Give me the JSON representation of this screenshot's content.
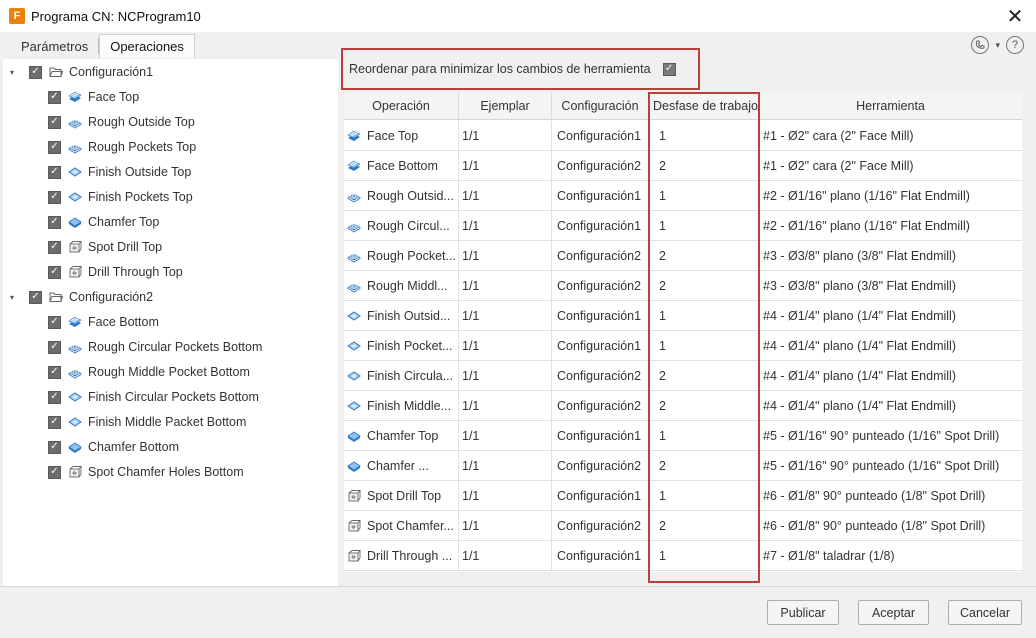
{
  "window": {
    "app_icon_letter": "F",
    "title": "Programa CN: NCProgram10",
    "close_glyph": "✕"
  },
  "tabs": [
    {
      "label": "Parámetros",
      "active": false
    },
    {
      "label": "Operaciones",
      "active": true
    }
  ],
  "header_icons": [
    "phone-icon",
    "chevron-down-icon",
    "help-icon"
  ],
  "tree": {
    "groups": [
      {
        "label": "Configuración1",
        "checked": true,
        "items": [
          {
            "label": "Face Top",
            "icon": "face-icon"
          },
          {
            "label": "Rough Outside Top",
            "icon": "adaptive-icon"
          },
          {
            "label": "Rough Pockets Top",
            "icon": "adaptive-icon"
          },
          {
            "label": "Finish Outside Top",
            "icon": "contour-icon"
          },
          {
            "label": "Finish Pockets Top",
            "icon": "contour-icon"
          },
          {
            "label": "Chamfer Top",
            "icon": "chamfer-icon"
          },
          {
            "label": "Spot Drill Top",
            "icon": "drill-icon"
          },
          {
            "label": "Drill Through Top",
            "icon": "drill-icon"
          }
        ]
      },
      {
        "label": "Configuración2",
        "checked": true,
        "items": [
          {
            "label": "Face Bottom",
            "icon": "face-icon"
          },
          {
            "label": "Rough Circular Pockets Bottom",
            "icon": "adaptive-icon"
          },
          {
            "label": "Rough Middle Pocket Bottom",
            "icon": "adaptive-icon"
          },
          {
            "label": "Finish Circular Pockets Bottom",
            "icon": "contour-icon"
          },
          {
            "label": "Finish Middle Packet Bottom",
            "icon": "contour-icon"
          },
          {
            "label": "Chamfer Bottom",
            "icon": "chamfer-icon"
          },
          {
            "label": "Spot Chamfer Holes Bottom",
            "icon": "drill-icon"
          }
        ]
      }
    ]
  },
  "reorder": {
    "label": "Reordenar para minimizar los cambios de herramienta",
    "checked": true
  },
  "table": {
    "columns": [
      "Operación",
      "Ejemplar",
      "Configuración",
      "Desfase de trabajo",
      "Herramienta"
    ],
    "rows": [
      {
        "op": "Face Top",
        "icon": "face-icon",
        "ejemplar": "1/1",
        "config": "Configuración1",
        "offset": "1",
        "tool": "#1 - Ø2\" cara (2\" Face Mill)"
      },
      {
        "op": "Face Bottom",
        "icon": "face-icon",
        "ejemplar": "1/1",
        "config": "Configuración2",
        "offset": "2",
        "tool": "#1 - Ø2\" cara (2\" Face Mill)"
      },
      {
        "op": "Rough Outsid...",
        "icon": "adaptive-icon",
        "ejemplar": "1/1",
        "config": "Configuración1",
        "offset": "1",
        "tool": "#2 - Ø1/16\" plano (1/16\" Flat Endmill)"
      },
      {
        "op": "Rough Circul...",
        "icon": "adaptive-icon",
        "ejemplar": "1/1",
        "config": "Configuración1",
        "offset": "1",
        "tool": "#2 - Ø1/16\" plano (1/16\" Flat Endmill)"
      },
      {
        "op": "Rough Pocket...",
        "icon": "adaptive-icon",
        "ejemplar": "1/1",
        "config": "Configuración2",
        "offset": "2",
        "tool": "#3 - Ø3/8\" plano (3/8\" Flat Endmill)"
      },
      {
        "op": "Rough Middl...",
        "icon": "adaptive-icon",
        "ejemplar": "1/1",
        "config": "Configuración2",
        "offset": "2",
        "tool": "#3 - Ø3/8\" plano (3/8\" Flat Endmill)"
      },
      {
        "op": "Finish Outsid...",
        "icon": "contour-icon",
        "ejemplar": "1/1",
        "config": "Configuración1",
        "offset": "1",
        "tool": "#4 - Ø1/4\" plano (1/4\" Flat Endmill)"
      },
      {
        "op": "Finish Pocket...",
        "icon": "contour-icon",
        "ejemplar": "1/1",
        "config": "Configuración1",
        "offset": "1",
        "tool": "#4 - Ø1/4\" plano (1/4\" Flat Endmill)"
      },
      {
        "op": "Finish Circula...",
        "icon": "contour-icon",
        "ejemplar": "1/1",
        "config": "Configuración2",
        "offset": "2",
        "tool": "#4 - Ø1/4\" plano (1/4\" Flat Endmill)"
      },
      {
        "op": "Finish Middle...",
        "icon": "contour-icon",
        "ejemplar": "1/1",
        "config": "Configuración2",
        "offset": "2",
        "tool": "#4 - Ø1/4\" plano (1/4\" Flat Endmill)"
      },
      {
        "op": "Chamfer Top",
        "icon": "chamfer-icon",
        "ejemplar": "1/1",
        "config": "Configuración1",
        "offset": "1",
        "tool": "#5 - Ø1/16\" 90° punteado (1/16\" Spot Drill)"
      },
      {
        "op": "Chamfer ...",
        "icon": "chamfer-icon",
        "ejemplar": "1/1",
        "config": "Configuración2",
        "offset": "2",
        "tool": "#5 - Ø1/16\" 90° punteado (1/16\" Spot Drill)"
      },
      {
        "op": "Spot Drill Top",
        "icon": "drill-icon",
        "ejemplar": "1/1",
        "config": "Configuración1",
        "offset": "1",
        "tool": "#6 - Ø1/8\" 90° punteado (1/8\" Spot Drill)"
      },
      {
        "op": "Spot Chamfer...",
        "icon": "drill-icon",
        "ejemplar": "1/1",
        "config": "Configuración2",
        "offset": "2",
        "tool": "#6 - Ø1/8\" 90° punteado (1/8\" Spot Drill)"
      },
      {
        "op": "Drill Through ...",
        "icon": "drill-icon",
        "ejemplar": "1/1",
        "config": "Configuración1",
        "offset": "1",
        "tool": "#7 - Ø1/8\" taladrar (1/8)"
      }
    ]
  },
  "buttons": {
    "publish": "Publicar",
    "accept": "Aceptar",
    "cancel": "Cancelar"
  },
  "colors": {
    "highlight_border": "#b5433a",
    "checkbox": "#6d6d6d",
    "icon_blue": "#2f78c4",
    "icon_light_blue": "#8fc3ee",
    "app_orange": "#e8820c"
  }
}
